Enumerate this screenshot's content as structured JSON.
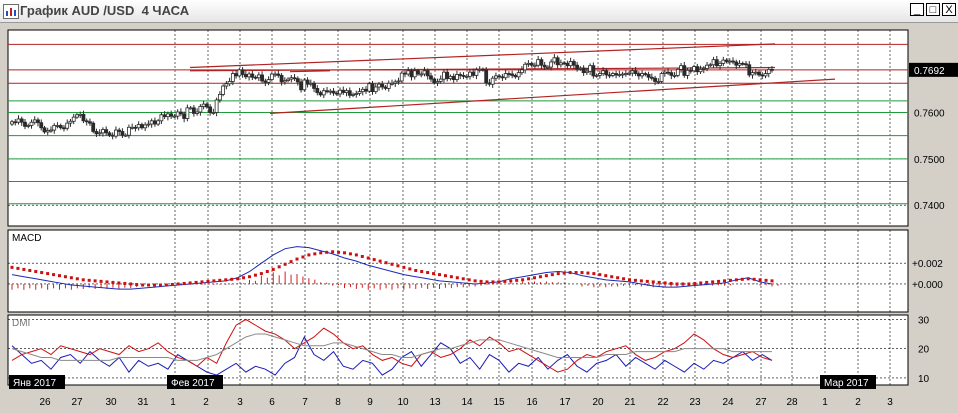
{
  "window": {
    "title": "График AUD /USD  4 ЧАСА",
    "buttons": {
      "minimize": "_",
      "maximize": "□",
      "close": "X"
    }
  },
  "colors": {
    "bull": "#2a2a2a",
    "bear": "#2a2a2a",
    "channel": "#b22222",
    "horizontal": "#b22222",
    "green_level": "#1f9a3a",
    "macd_line": "#1a2ab8",
    "signal_dots": "#cc1010",
    "hist": "#cc2020",
    "dmi_plus": "#1a1ab8",
    "dmi_minus": "#d01010",
    "adx": "#8a8a8a",
    "price_tag": "#000000"
  },
  "chart_data": [
    {
      "type": "candlestick",
      "title": "AUD /USD 4 ЧАСА",
      "ylim": [
        0.7355,
        0.7778
      ],
      "y_ticks": [
        {
          "value": 0.76,
          "label": "0.7600"
        },
        {
          "value": 0.75,
          "label": "0.7500"
        },
        {
          "value": 0.74,
          "label": "0.7400"
        }
      ],
      "current_price": {
        "value": 0.7692,
        "label": "0.7692"
      },
      "horizontal_lines": [
        0.7747,
        0.7692,
        0.7663
      ],
      "green_levels": [
        0.7625,
        0.76,
        0.755,
        0.75,
        0.7451,
        0.7403
      ],
      "channel_upper": [
        [
          0.769,
          0.7697
        ],
        [
          0.7697,
          0.7748
        ]
      ],
      "channel_lower": [
        [
          0.7598,
          0.7672
        ]
      ],
      "x_date_labels": [
        "26",
        "27",
        "30",
        "31",
        "1",
        "2",
        "3",
        "6",
        "7",
        "8",
        "9",
        "10",
        "13",
        "14",
        "15",
        "16",
        "17",
        "20",
        "21",
        "22",
        "23",
        "24",
        "27",
        "28",
        "1",
        "2",
        "3"
      ],
      "month_labels": [
        "Янв 2017",
        "Фев 2017",
        "Мар 2017"
      ],
      "series_close": [
        0.758,
        0.7579,
        0.7586,
        0.7579,
        0.757,
        0.7572,
        0.7579,
        0.7584,
        0.7578,
        0.7567,
        0.7558,
        0.7561,
        0.7562,
        0.7572,
        0.7572,
        0.7567,
        0.7566,
        0.7577,
        0.7581,
        0.759,
        0.7595,
        0.7596,
        0.7582,
        0.758,
        0.7577,
        0.7559,
        0.7554,
        0.7556,
        0.7563,
        0.7556,
        0.7551,
        0.7549,
        0.7562,
        0.7559,
        0.7551,
        0.7551,
        0.7568,
        0.7568,
        0.7567,
        0.7574,
        0.7567,
        0.7573,
        0.7575,
        0.7582,
        0.7575,
        0.7582,
        0.7595,
        0.7591,
        0.7597,
        0.7592,
        0.7592,
        0.7601,
        0.7597,
        0.7587,
        0.761,
        0.761,
        0.7598,
        0.7601,
        0.7613,
        0.7618,
        0.7612,
        0.76,
        0.76,
        0.7627,
        0.7639,
        0.7657,
        0.7662,
        0.7667,
        0.7684,
        0.7679,
        0.7692,
        0.7682,
        0.7677,
        0.7683,
        0.7676,
        0.7675,
        0.7681,
        0.7668,
        0.7665,
        0.7671,
        0.7683,
        0.7683,
        0.768,
        0.7666,
        0.7669,
        0.7672,
        0.7675,
        0.7673,
        0.7666,
        0.7649,
        0.767,
        0.7661,
        0.7663,
        0.7652,
        0.7643,
        0.7638,
        0.7647,
        0.7646,
        0.7646,
        0.7642,
        0.764,
        0.7648,
        0.7643,
        0.7647,
        0.7637,
        0.7639,
        0.7641,
        0.7645,
        0.765,
        0.7646,
        0.7662,
        0.7645,
        0.7655,
        0.7661,
        0.7655,
        0.7652,
        0.7663,
        0.7663,
        0.7666,
        0.7668,
        0.7685,
        0.7683,
        0.769,
        0.7677,
        0.769,
        0.7683,
        0.7683,
        0.769,
        0.7679,
        0.7672,
        0.7664,
        0.7667,
        0.7672,
        0.7687,
        0.7673,
        0.7678,
        0.7671,
        0.7682,
        0.768,
        0.7678,
        0.7678,
        0.7687,
        0.768,
        0.7692,
        0.7693,
        0.7692,
        0.7664,
        0.7661,
        0.7674,
        0.7679,
        0.7677,
        0.7675,
        0.7684,
        0.7683,
        0.768,
        0.7677,
        0.7686,
        0.7692,
        0.7704,
        0.7706,
        0.7702,
        0.7702,
        0.7714,
        0.7702,
        0.7698,
        0.7698,
        0.7709,
        0.7718,
        0.7703,
        0.7707,
        0.7706,
        0.7701,
        0.771,
        0.7702,
        0.7694,
        0.7696,
        0.7686,
        0.7689,
        0.7701,
        0.7679,
        0.768,
        0.7684,
        0.769,
        0.7681,
        0.768,
        0.7684,
        0.7681,
        0.7682,
        0.7683,
        0.7684,
        0.7685,
        0.769,
        0.7684,
        0.7679,
        0.7684,
        0.7682,
        0.7676,
        0.7674,
        0.7667,
        0.7667,
        0.7684,
        0.7687,
        0.7686,
        0.768,
        0.768,
        0.7693,
        0.7701,
        0.768,
        0.7691,
        0.769,
        0.7699,
        0.7688,
        0.7693,
        0.7695,
        0.7702,
        0.7703,
        0.7714,
        0.7701,
        0.7706,
        0.7713,
        0.771,
        0.7711,
        0.7709,
        0.7702,
        0.7706,
        0.7705,
        0.7703,
        0.7681,
        0.7686,
        0.7687,
        0.7681,
        0.7679,
        0.7684,
        0.7693,
        0.7692
      ]
    },
    {
      "type": "line",
      "title": "MACD",
      "ylim": [
        -0.0027,
        0.0052
      ],
      "y_ticks": [
        {
          "value": 0.002,
          "label": "+0.002"
        },
        {
          "value": 0.0,
          "label": "+0.000"
        }
      ],
      "series": [
        {
          "name": "MACD",
          "values": [
            0.0009,
            0.0007,
            0.0005,
            0.0003,
            0.0001,
            -0.0001,
            -0.0002,
            -0.0003,
            -0.0004,
            -0.0005,
            -0.0005,
            -0.0004,
            -0.0003,
            -0.0002,
            -0.0001,
            0.0,
            0.0001,
            0.0002,
            0.0003,
            0.0006,
            0.0012,
            0.002,
            0.0028,
            0.0034,
            0.0036,
            0.0035,
            0.0032,
            0.0029,
            0.0025,
            0.0022,
            0.0018,
            0.0015,
            0.0012,
            0.0009,
            0.0007,
            0.0005,
            0.0003,
            0.0002,
            0.0001,
            0.0,
            0.0001,
            0.0002,
            0.0005,
            0.0007,
            0.0009,
            0.0011,
            0.0012,
            0.0011,
            0.0008,
            0.0006,
            0.0004,
            0.0003,
            0.0002,
            0.0,
            -0.0002,
            -0.0003,
            -0.0003,
            -0.0002,
            -0.0001,
            0.0,
            0.0001,
            0.0004,
            0.0006,
            0.0002,
            0.0
          ]
        }
      ],
      "signal_dots": [
        0.0016,
        0.0014,
        0.0012,
        0.001,
        0.0008,
        0.0006,
        0.0004,
        0.0003,
        0.0002,
        0.0001,
        0.0,
        -0.0001,
        -0.0001,
        -0.0001,
        0.0,
        0.0001,
        0.0002,
        0.0003,
        0.0004,
        0.0005,
        0.0007,
        0.001,
        0.0014,
        0.0019,
        0.0024,
        0.0028,
        0.003,
        0.0031,
        0.003,
        0.0028,
        0.0025,
        0.0022,
        0.0019,
        0.0016,
        0.0013,
        0.0011,
        0.0009,
        0.0007,
        0.0005,
        0.0003,
        0.0002,
        0.0002,
        0.0003,
        0.0004,
        0.0006,
        0.0008,
        0.001,
        0.0011,
        0.0011,
        0.001,
        0.0008,
        0.0006,
        0.0004,
        0.0003,
        0.0002,
        0.0001,
        0.0,
        0.0,
        0.0001,
        0.0002,
        0.0003,
        0.0004,
        0.0005,
        0.0004,
        0.0003
      ]
    },
    {
      "type": "line",
      "title": "DMI",
      "ylim": [
        7.6,
        31.5
      ],
      "y_ticks": [
        {
          "value": 30,
          "label": "30"
        },
        {
          "value": 20,
          "label": "20"
        },
        {
          "value": 10,
          "label": "10"
        }
      ],
      "series": [
        {
          "name": "+DI",
          "values": [
            21,
            18,
            15,
            16,
            13,
            17,
            18,
            15,
            19,
            16,
            14,
            17,
            12,
            16,
            14,
            15,
            13,
            18,
            16,
            14,
            12,
            11,
            13,
            15,
            12,
            14,
            13,
            11,
            15,
            17,
            24,
            18,
            16,
            19,
            14,
            13,
            16,
            15,
            11,
            13,
            17,
            19,
            14,
            18,
            22,
            20,
            15,
            17,
            13,
            18,
            16,
            12,
            15,
            14,
            17,
            13,
            16,
            18,
            14,
            12,
            15,
            16,
            18,
            14,
            17,
            15,
            13,
            16,
            14,
            12,
            15,
            13,
            16,
            15,
            17,
            19,
            16,
            18,
            16
          ]
        },
        {
          "name": "-DI",
          "values": [
            16,
            18,
            19,
            20,
            18,
            21,
            20,
            19,
            18,
            20,
            19,
            18,
            21,
            19,
            20,
            22,
            19,
            17,
            16,
            14,
            17,
            15,
            22,
            28,
            30,
            28,
            26,
            25,
            23,
            20,
            22,
            24,
            27,
            25,
            22,
            20,
            21,
            18,
            16,
            17,
            15,
            14,
            18,
            19,
            17,
            18,
            20,
            23,
            21,
            24,
            22,
            19,
            20,
            18,
            16,
            14,
            12,
            13,
            16,
            18,
            17,
            19,
            20,
            21,
            18,
            16,
            17,
            19,
            20,
            22,
            25,
            23,
            20,
            18,
            17,
            18,
            19,
            17,
            16
          ]
        },
        {
          "name": "ADX",
          "values": [
            20,
            19,
            18,
            17,
            17,
            16,
            16,
            16,
            16,
            16,
            16,
            17,
            17,
            17,
            17,
            17,
            17,
            16,
            16,
            16,
            17,
            18,
            20,
            22,
            24,
            25,
            25,
            24,
            23,
            22,
            21,
            21,
            21,
            22,
            22,
            21,
            20,
            19,
            18,
            18,
            17,
            17,
            18,
            19,
            20,
            20,
            21,
            22,
            23,
            23,
            23,
            22,
            21,
            20,
            19,
            18,
            17,
            17,
            17,
            17,
            17,
            18,
            18,
            18,
            19,
            19,
            19,
            19,
            19,
            20,
            20,
            20,
            20,
            20,
            19,
            19,
            19,
            19,
            19
          ]
        }
      ]
    }
  ]
}
